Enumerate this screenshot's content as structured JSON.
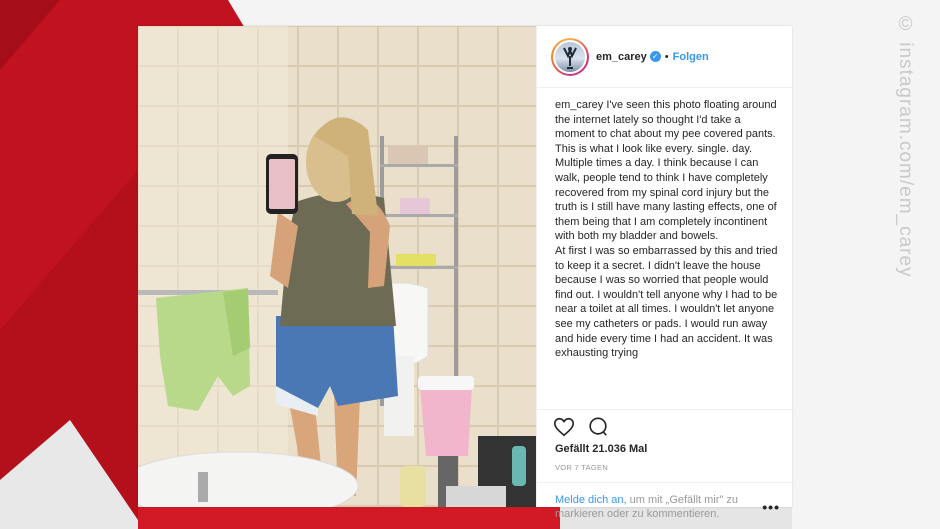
{
  "watermark": "© instagram.com/em_carey",
  "post": {
    "username": "em_carey",
    "verified_icon": "verified-badge-icon",
    "separator": "•",
    "follow_label": "Folgen",
    "caption": [
      "em_carey I've seen this photo floating around the internet lately so thought I'd take a moment to chat about my pee covered pants.",
      "This is what I look like every. single. day. Multiple times a day. I think because I can walk, people tend to think I have completely recovered from my spinal cord injury but the truth is I still have many lasting effects, one of them being that I am completely incontinent with both my bladder and bowels.",
      "At first I was so embarrassed by this and tried to keep it a secret. I didn't leave the house because I was so worried that people would find out. I wouldn't tell anyone why I had to be near a toilet at all times. I wouldn't let anyone see my catheters or pads. I would run away and hide every time I had an accident. It was exhausting trying"
    ],
    "likes": "Gefällt 21.036 Mal",
    "date": "VOR 7 TAGEN",
    "footer": {
      "login_link": "Melde dich an,",
      "rest": " um mit „Gefällt mir\" zu markieren oder zu kommentieren."
    },
    "more_label": "•••",
    "icons": {
      "like": "heart-icon",
      "comment": "comment-icon"
    }
  },
  "colors": {
    "red": "#c1121f",
    "link_blue": "#3897f0"
  }
}
